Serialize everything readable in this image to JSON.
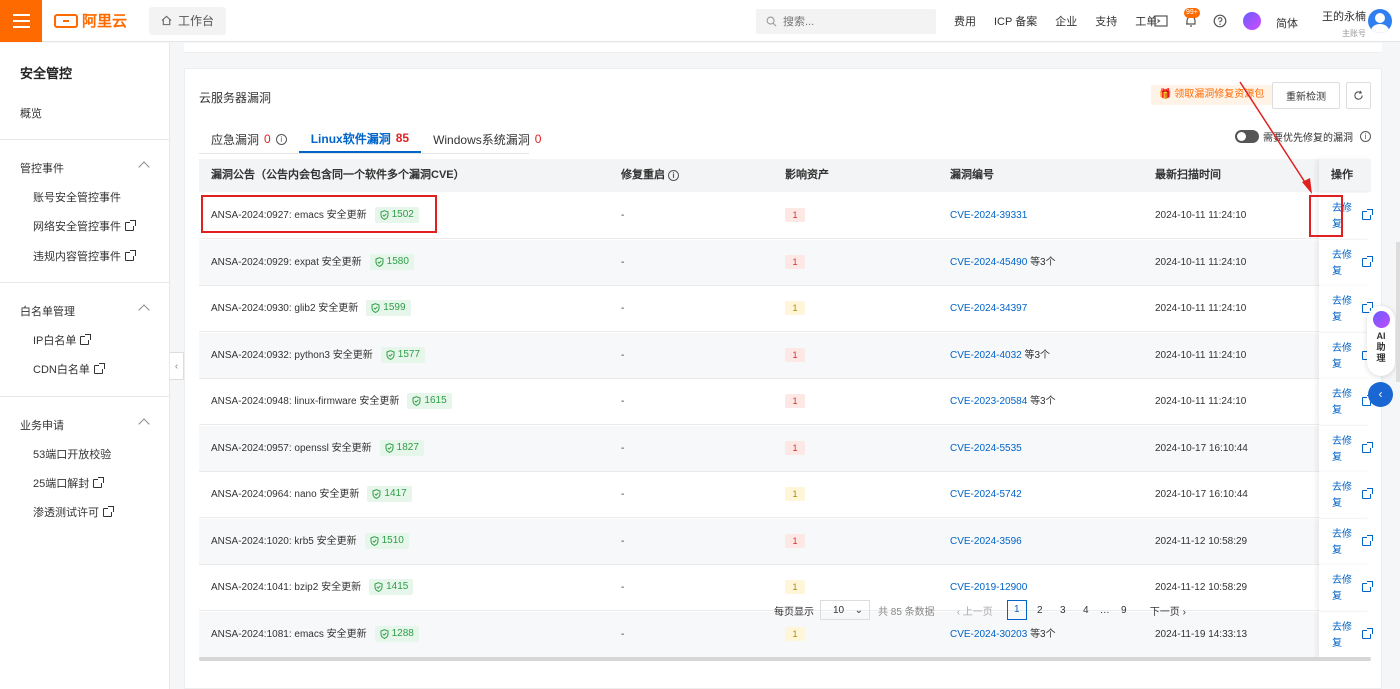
{
  "topbar": {
    "logo_text": "阿里云",
    "workbench_label": "工作台",
    "search_placeholder": "搜索...",
    "nav": [
      "费用",
      "ICP 备案",
      "企业",
      "支持",
      "工单"
    ],
    "notification_badge": "99+",
    "lang_label": "简体",
    "user_name": "王的永楠",
    "user_role": "主账号"
  },
  "sidebar": {
    "title": "安全管控",
    "overview": "概览",
    "group1": {
      "label": "管控事件",
      "items": [
        "账号安全管控事件",
        "网络安全管控事件",
        "违规内容管控事件"
      ]
    },
    "group2": {
      "label": "白名单管理",
      "items": [
        "IP白名单",
        "CDN白名单"
      ]
    },
    "group3": {
      "label": "业务申请",
      "items": [
        "53端口开放校验",
        "25端口解封",
        "渗透测试许可"
      ]
    }
  },
  "main": {
    "title": "云服务器漏洞",
    "promo_label": "领取漏洞修复资源包",
    "recheck_label": "重新检测",
    "tabs": [
      {
        "label": "应急漏洞",
        "count": "0"
      },
      {
        "label": "Linux软件漏洞",
        "count": "85"
      },
      {
        "label": "Windows系统漏洞",
        "count": "0"
      }
    ],
    "toggle_label": "需要优先修复的漏洞",
    "columns": {
      "notice": "漏洞公告（公告内会包含同一个软件多个漏洞CVE）",
      "restart": "修复重启",
      "assets": "影响资产",
      "cve": "漏洞编号",
      "scan_time": "最新扫描时间",
      "action": "操作"
    },
    "rows": [
      {
        "notice": "ANSA-2024:0927: emacs 安全更新",
        "score": "1502",
        "restart": "-",
        "assets": "1",
        "level": "red",
        "cve": "CVE-2024-39331",
        "extra": "",
        "time": "2024-10-11 11:24:10"
      },
      {
        "notice": "ANSA-2024:0929: expat 安全更新",
        "score": "1580",
        "restart": "-",
        "assets": "1",
        "level": "red",
        "cve": "CVE-2024-45490",
        "extra": "等3个",
        "time": "2024-10-11 11:24:10"
      },
      {
        "notice": "ANSA-2024:0930: glib2 安全更新",
        "score": "1599",
        "restart": "-",
        "assets": "1",
        "level": "yellow",
        "cve": "CVE-2024-34397",
        "extra": "",
        "time": "2024-10-11 11:24:10"
      },
      {
        "notice": "ANSA-2024:0932: python3 安全更新",
        "score": "1577",
        "restart": "-",
        "assets": "1",
        "level": "red",
        "cve": "CVE-2024-4032",
        "extra": "等3个",
        "time": "2024-10-11 11:24:10"
      },
      {
        "notice": "ANSA-2024:0948: linux-firmware 安全更新",
        "score": "1615",
        "restart": "-",
        "assets": "1",
        "level": "red",
        "cve": "CVE-2023-20584",
        "extra": "等3个",
        "time": "2024-10-11 11:24:10"
      },
      {
        "notice": "ANSA-2024:0957: openssl 安全更新",
        "score": "1827",
        "restart": "-",
        "assets": "1",
        "level": "red",
        "cve": "CVE-2024-5535",
        "extra": "",
        "time": "2024-10-17 16:10:44"
      },
      {
        "notice": "ANSA-2024:0964: nano 安全更新",
        "score": "1417",
        "restart": "-",
        "assets": "1",
        "level": "yellow",
        "cve": "CVE-2024-5742",
        "extra": "",
        "time": "2024-10-17 16:10:44"
      },
      {
        "notice": "ANSA-2024:1020: krb5 安全更新",
        "score": "1510",
        "restart": "-",
        "assets": "1",
        "level": "red",
        "cve": "CVE-2024-3596",
        "extra": "",
        "time": "2024-11-12 10:58:29"
      },
      {
        "notice": "ANSA-2024:1041: bzip2 安全更新",
        "score": "1415",
        "restart": "-",
        "assets": "1",
        "level": "yellow",
        "cve": "CVE-2019-12900",
        "extra": "",
        "time": "2024-11-12 10:58:29"
      },
      {
        "notice": "ANSA-2024:1081: emacs 安全更新",
        "score": "1288",
        "restart": "-",
        "assets": "1",
        "level": "yellow",
        "cve": "CVE-2024-30203",
        "extra": "等3个",
        "time": "2024-11-19 14:33:13"
      }
    ],
    "fix_label": "去修复"
  },
  "pager": {
    "per_page_label": "每页显示",
    "per_page_value": "10",
    "total_label": "共 85 条数据",
    "prev_label": "上一页",
    "pages": [
      "1",
      "2",
      "3",
      "4",
      "…",
      "9"
    ],
    "next_label": "下一页"
  },
  "float": {
    "ai_label": "AI助理"
  },
  "colors": {
    "brand": "#ff6a00",
    "link": "#0064c8",
    "highlight": "#e02020"
  }
}
